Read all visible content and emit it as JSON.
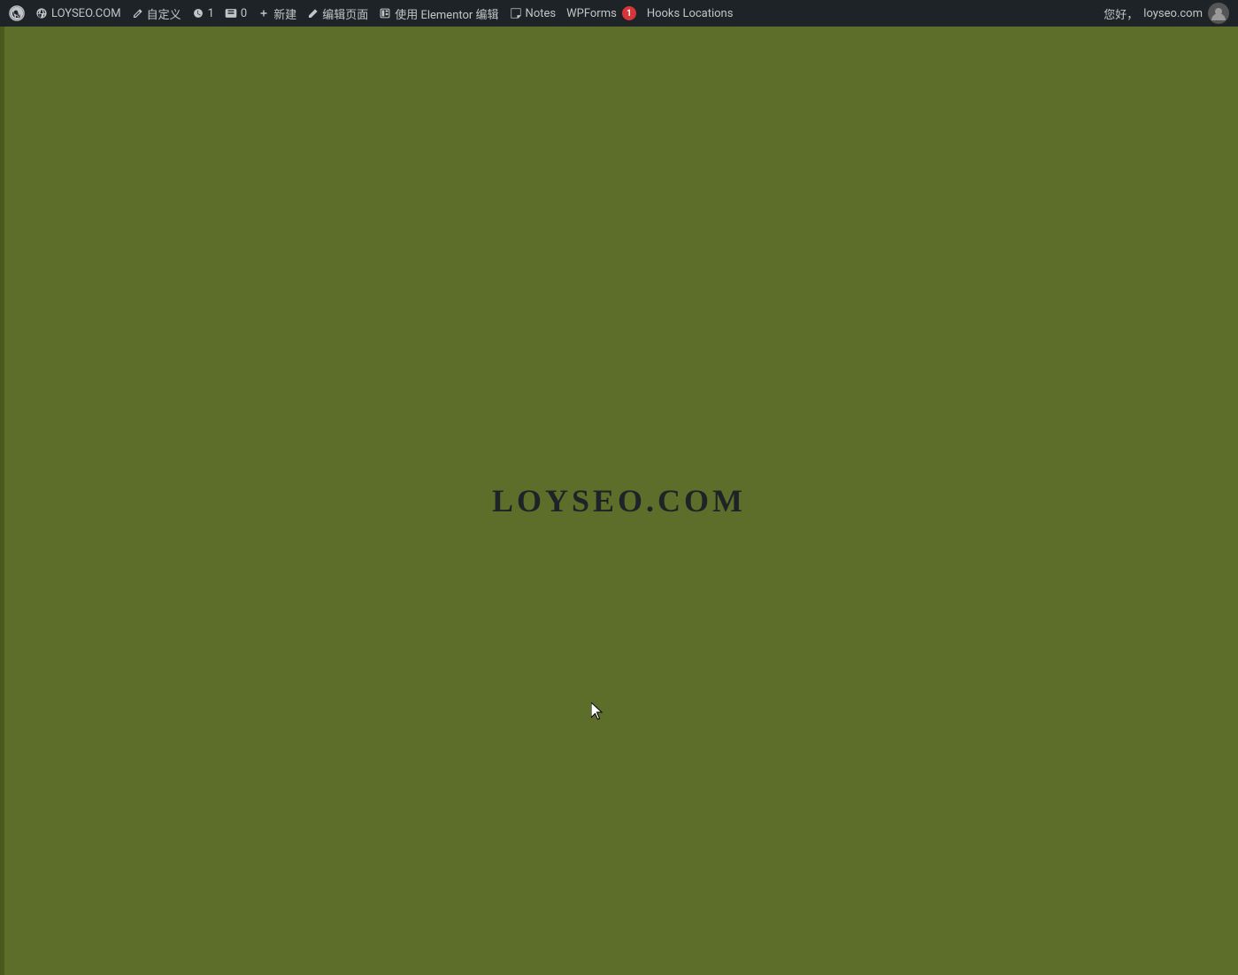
{
  "adminbar": {
    "wp_logo_label": "WordPress",
    "site_name": "LOYSEO.COM",
    "customize_label": "自定义",
    "updates_count": "1",
    "comments_count": "0",
    "new_label": "新建",
    "edit_page_label": "编辑页面",
    "elementor_label": "使用 Elementor 编辑",
    "notes_label": "Notes",
    "wpforms_label": "WPForms",
    "wpforms_badge": "1",
    "hooks_label": "Hooks Locations",
    "greeting": "您好，",
    "username": "loyseo.com"
  },
  "main": {
    "site_title": "LOYSEO.COM",
    "bg_color": "#5c6e2a"
  }
}
